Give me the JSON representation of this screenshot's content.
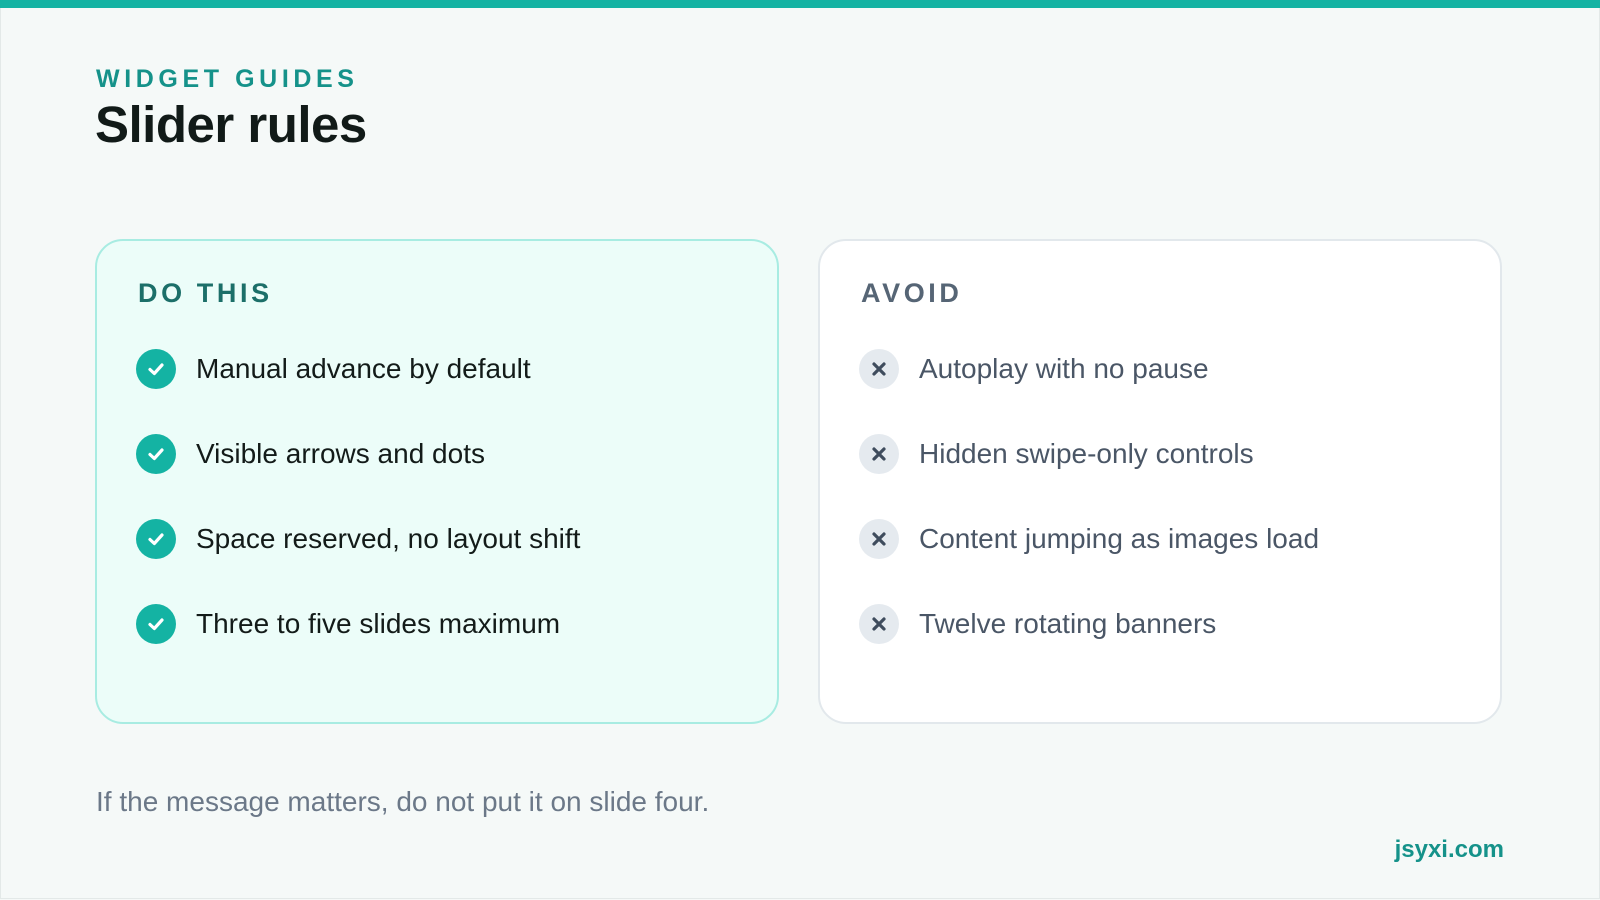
{
  "header": {
    "eyebrow": "WIDGET GUIDES",
    "title": "Slider rules"
  },
  "do_card": {
    "heading": "DO THIS",
    "icon": "check-circle-icon",
    "items": [
      "Manual advance by default",
      "Visible arrows and dots",
      "Space reserved, no layout shift",
      "Three to five slides maximum"
    ]
  },
  "avoid_card": {
    "heading": "AVOID",
    "icon": "x-circle-icon",
    "items": [
      "Autoplay with no pause",
      "Hidden swipe-only controls",
      "Content jumping as images load",
      "Twelve rotating banners"
    ]
  },
  "footer": {
    "note": "If the message matters, do not put it on slide four.",
    "brand": "jsyxi.com"
  },
  "colors": {
    "accent": "#14b3a3",
    "accent_text": "#15928a",
    "do_card_bg": "#ecfdf9",
    "do_card_border": "#a8ece2",
    "avoid_card_bg": "#ffffff",
    "avoid_icon_bg": "#e5eaef",
    "page_bg": "#f5f9f8"
  }
}
